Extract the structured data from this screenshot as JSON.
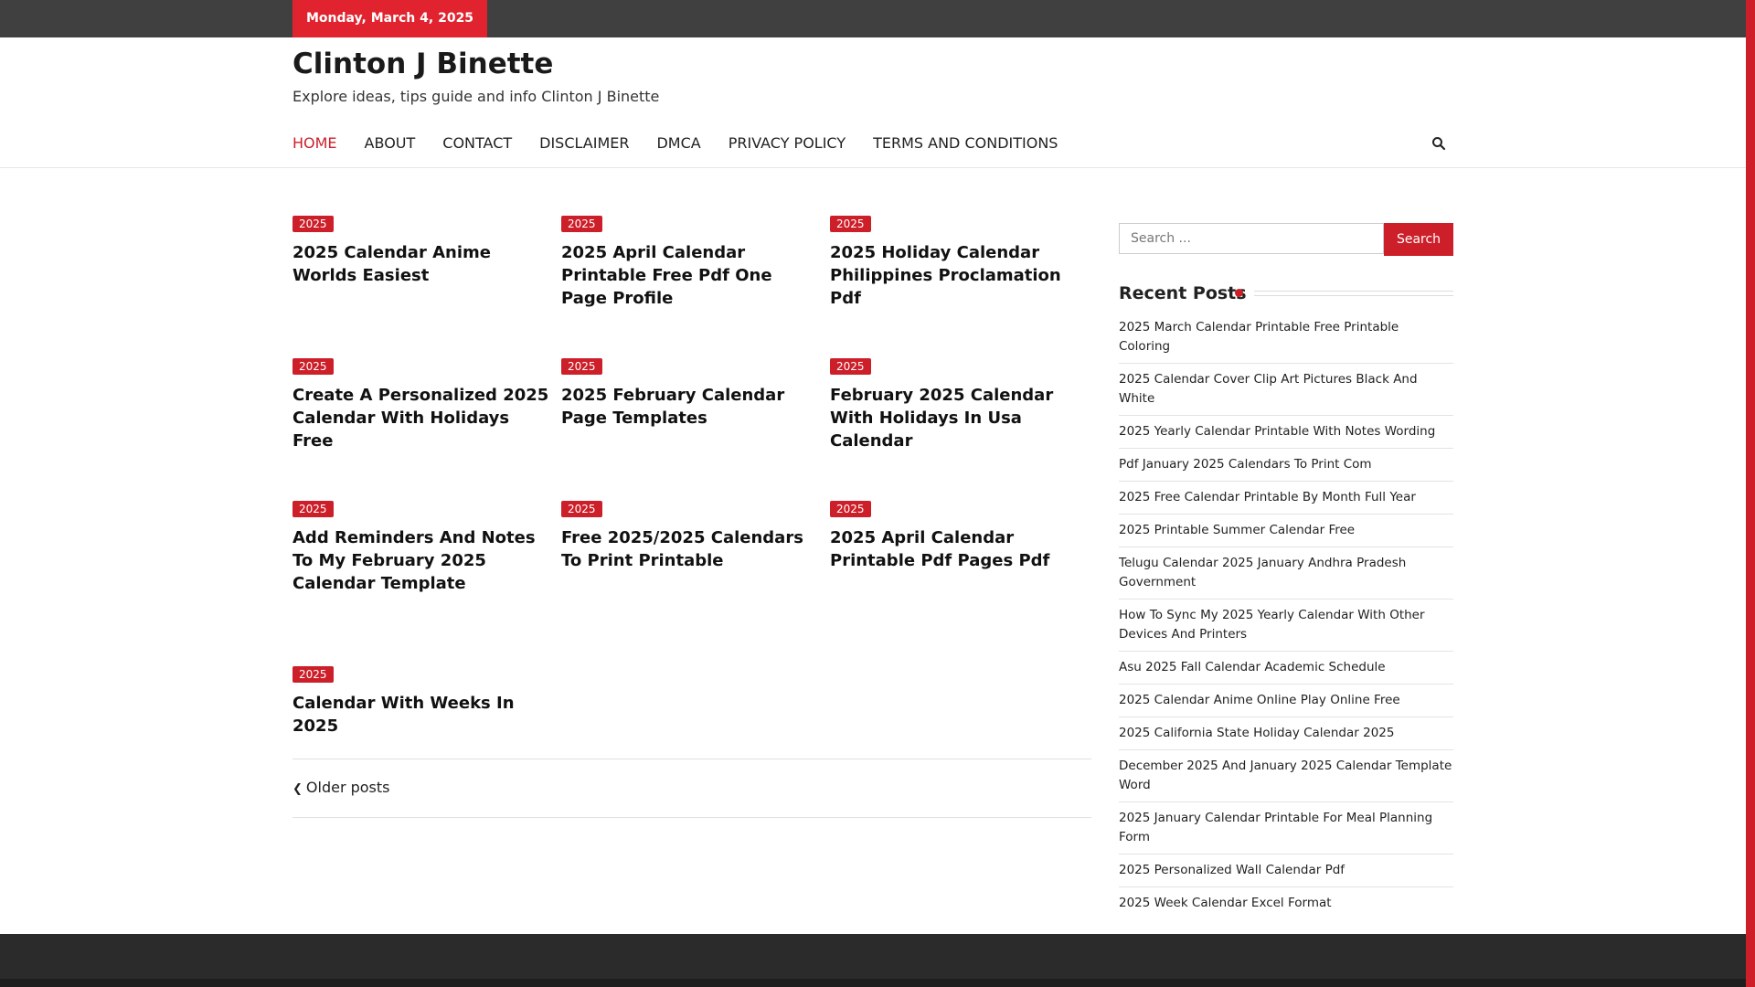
{
  "topbar": {
    "date": "Monday, March 4, 2025"
  },
  "site": {
    "title": "Clinton J Binette",
    "description": "Explore ideas, tips guide and info Clinton J Binette"
  },
  "nav": {
    "items": [
      "HOME",
      "ABOUT",
      "CONTACT",
      "DISCLAIMER",
      "DMCA",
      "PRIVACY POLICY",
      "TERMS AND CONDITIONS"
    ],
    "active": "HOME",
    "search_icon": "search-icon"
  },
  "posts": [
    {
      "category": "2025",
      "title": "2025 Calendar Anime Worlds Easiest"
    },
    {
      "category": "2025",
      "title": "2025 April Calendar Printable Free Pdf One Page Profile"
    },
    {
      "category": "2025",
      "title": "2025 Holiday Calendar Philippines Proclamation Pdf"
    },
    {
      "category": "2025",
      "title": "Create A Personalized 2025 Calendar With Holidays Free"
    },
    {
      "category": "2025",
      "title": "2025 February Calendar Page Templates"
    },
    {
      "category": "2025",
      "title": "February 2025 Calendar With Holidays In Usa Calendar"
    },
    {
      "category": "2025",
      "title": "Add Reminders And Notes To My February 2025 Calendar Template"
    },
    {
      "category": "2025",
      "title": "Free 2025/2025 Calendars To Print Printable"
    },
    {
      "category": "2025",
      "title": "2025 April Calendar Printable Pdf Pages Pdf"
    },
    {
      "category": "2025",
      "title": "Calendar With Weeks In 2025"
    }
  ],
  "pagination": {
    "older_label": "Older posts"
  },
  "sidebar": {
    "search": {
      "placeholder": "Search ...",
      "button": "Search"
    },
    "recent_heading": "Recent Posts",
    "recent_posts": [
      "2025 March Calendar Printable Free Printable Coloring",
      "2025 Calendar Cover Clip Art Pictures Black And White",
      "2025 Yearly Calendar Printable With Notes Wording",
      "Pdf January 2025 Calendars To Print Com",
      "2025 Free Calendar Printable By Month Full Year",
      "2025 Printable Summer Calendar Free",
      "Telugu Calendar 2025 January Andhra Pradesh Government",
      "How To Sync My 2025 Yearly Calendar With Other Devices And Printers",
      "Asu 2025 Fall Calendar Academic Schedule",
      "2025 Calendar Anime Online Play Online Free",
      "2025 California State Holiday Calendar 2025",
      "December 2025 And January 2025 Calendar Template Word",
      "2025 January Calendar Printable For Meal Planning Form",
      "2025 Personalized Wall Calendar Pdf",
      "2025 Week Calendar Excel Format"
    ]
  },
  "colors": {
    "accent": "#cd1f29",
    "topbar": "#404040",
    "footer": "#2b2b2b"
  }
}
